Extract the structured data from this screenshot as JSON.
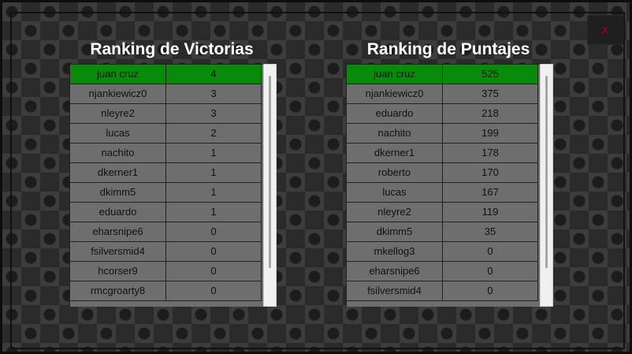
{
  "close_label": "X",
  "victorias": {
    "title": "Ranking de Victorias",
    "rows": [
      {
        "name": "juan cruz",
        "value": "4"
      },
      {
        "name": "njankiewicz0",
        "value": "3"
      },
      {
        "name": "nleyre2",
        "value": "3"
      },
      {
        "name": "lucas",
        "value": "2"
      },
      {
        "name": "nachito",
        "value": "1"
      },
      {
        "name": "dkerner1",
        "value": "1"
      },
      {
        "name": "dkimm5",
        "value": "1"
      },
      {
        "name": "eduardo",
        "value": "1"
      },
      {
        "name": "eharsnipe6",
        "value": "0"
      },
      {
        "name": "fsilversmid4",
        "value": "0"
      },
      {
        "name": "hcorser9",
        "value": "0"
      },
      {
        "name": "rmcgroarty8",
        "value": "0"
      }
    ]
  },
  "puntajes": {
    "title": "Ranking de Puntajes",
    "rows": [
      {
        "name": "juan cruz",
        "value": "525"
      },
      {
        "name": "njankiewicz0",
        "value": "375"
      },
      {
        "name": "eduardo",
        "value": "218"
      },
      {
        "name": "nachito",
        "value": "199"
      },
      {
        "name": "dkerner1",
        "value": "178"
      },
      {
        "name": "roberto",
        "value": "170"
      },
      {
        "name": "lucas",
        "value": "167"
      },
      {
        "name": "nleyre2",
        "value": "119"
      },
      {
        "name": "dkimm5",
        "value": "35"
      },
      {
        "name": "mkellog3",
        "value": "0"
      },
      {
        "name": "eharsnipe6",
        "value": "0"
      },
      {
        "name": "fsilversmid4",
        "value": "0"
      }
    ]
  },
  "colors": {
    "selected_row": "#0a8a0a",
    "row_bg": "#6e6e6e",
    "close_x": "#b30000"
  }
}
